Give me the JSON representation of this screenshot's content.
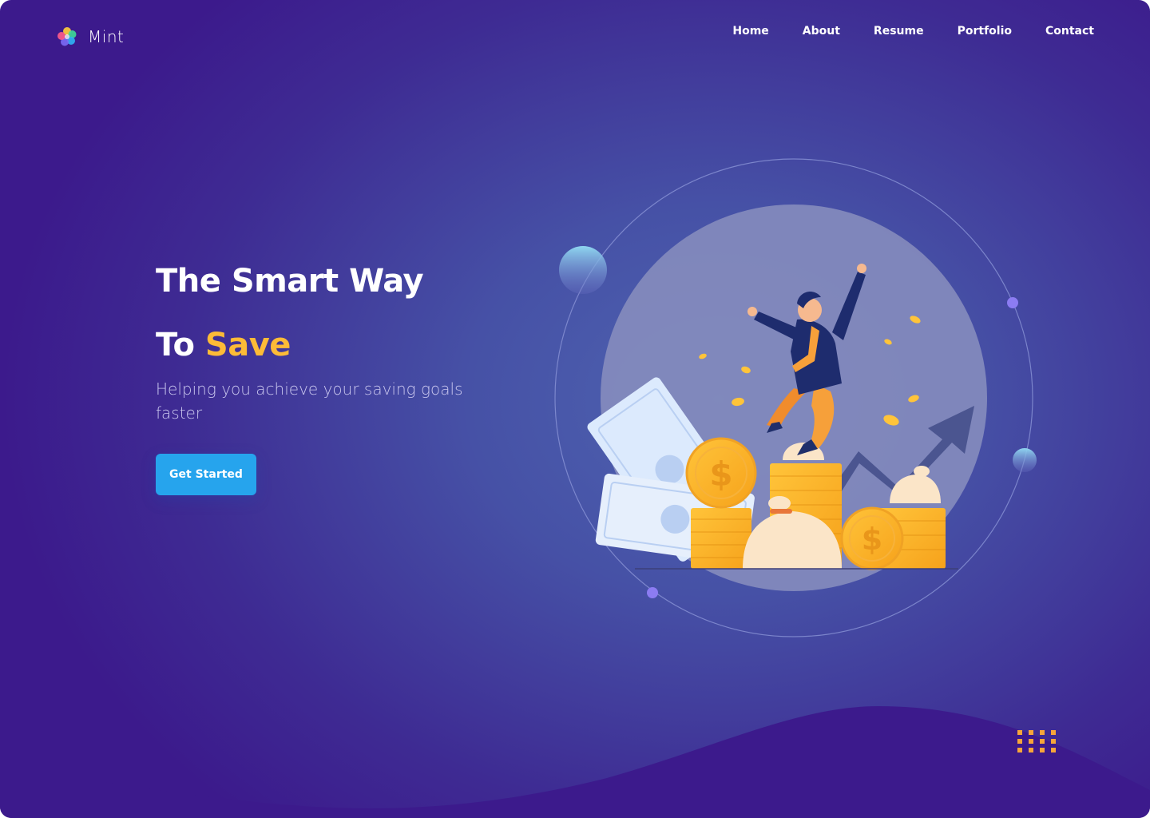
{
  "header": {
    "brand": "Mint",
    "nav": [
      {
        "label": "Home"
      },
      {
        "label": "About"
      },
      {
        "label": "Resume"
      },
      {
        "label": "Portfolio"
      },
      {
        "label": "Contact"
      }
    ]
  },
  "hero": {
    "title_line1": "The Smart Way",
    "title_line2_prefix": "To",
    "title_line2_accent": "Save",
    "subtitle": "Helping you achieve your saving goals faster",
    "cta_label": "Get Started"
  },
  "colors": {
    "accent_yellow": "#fdbb37",
    "button_blue": "#26a4ed",
    "background_purple": "#3c1a8c",
    "background_blue": "#4e63b0"
  },
  "icons": {
    "logo": "flower-logo-icon",
    "illustration": "jumping-man-with-money-illustration",
    "decoration": "dot-grid-icon"
  }
}
